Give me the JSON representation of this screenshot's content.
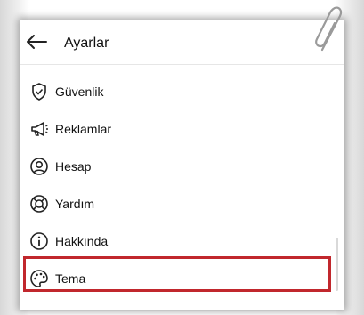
{
  "header": {
    "title": "Ayarlar",
    "back_icon": "arrow-left-icon"
  },
  "menu": [
    {
      "label": "Güvenlik",
      "icon": "shield-check-icon"
    },
    {
      "label": "Reklamlar",
      "icon": "megaphone-icon"
    },
    {
      "label": "Hesap",
      "icon": "account-circle-icon"
    },
    {
      "label": "Yardım",
      "icon": "lifebuoy-icon"
    },
    {
      "label": "Hakkında",
      "icon": "info-icon"
    },
    {
      "label": "Tema",
      "icon": "palette-icon",
      "highlighted": true
    }
  ],
  "colors": {
    "highlight": "#c1272d",
    "text": "#111111"
  }
}
